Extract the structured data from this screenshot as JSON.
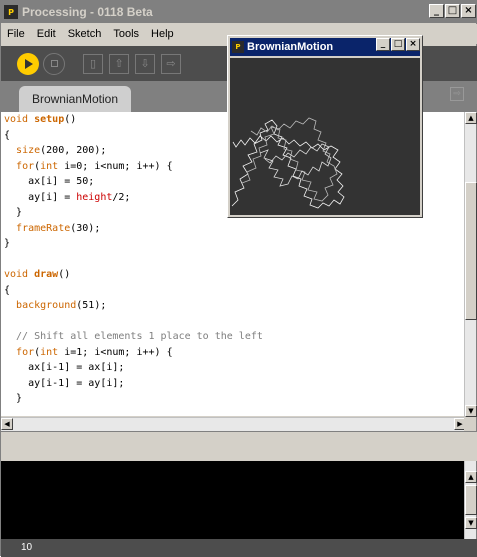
{
  "main_window": {
    "title": "Processing - 0118 Beta",
    "app_icon_text": "P",
    "menu": [
      "File",
      "Edit",
      "Sketch",
      "Tools",
      "Help"
    ],
    "tab_label": "BrownianMotion",
    "status_text": "10"
  },
  "code": [
    "void setup()",
    "{",
    "  size(200, 200);",
    "  for(int i=0; i<num; i++) {",
    "    ax[i] = 50;",
    "    ay[i] = height/2;",
    "  }",
    "  frameRate(30);",
    "}",
    "",
    "void draw()",
    "{",
    "  background(51);",
    "",
    "  // Shift all elements 1 place to the left",
    "  for(int i=1; i<num; i++) {",
    "    ax[i-1] = ax[i];",
    "    ay[i-1] = ay[i];",
    "  }"
  ],
  "sketch_window": {
    "title": "BrownianMotion",
    "background_color": "#333333",
    "stroke_color": "#ffffff"
  },
  "colors": {
    "toolbar_bg": "#4d4d4d",
    "run_button": "#ffcc00",
    "keyword": "#cc6600",
    "builtin_var": "#cc0000",
    "comment": "#7e7e7e"
  }
}
